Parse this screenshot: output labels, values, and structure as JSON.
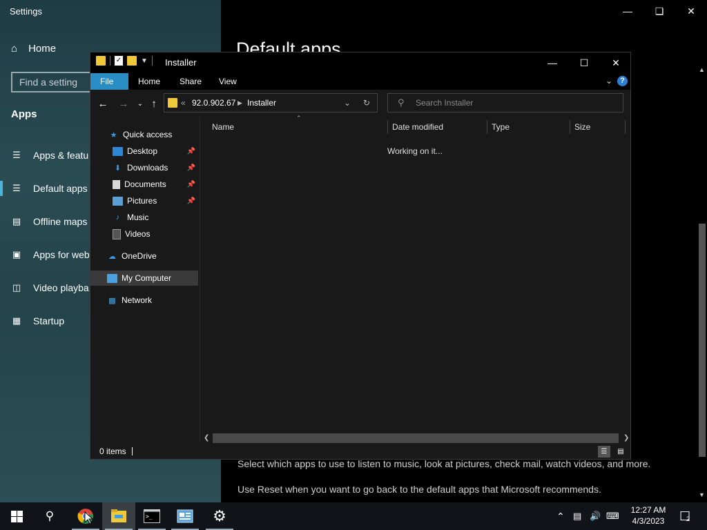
{
  "settings": {
    "title": "Settings",
    "home_label": "Home",
    "search_placeholder": "Find a setting",
    "section_heading": "Apps",
    "nav_items": [
      {
        "label": "Apps & featu",
        "icon": "list-icon"
      },
      {
        "label": "Default apps",
        "icon": "default-apps-icon"
      },
      {
        "label": "Offline maps",
        "icon": "map-icon"
      },
      {
        "label": "Apps for web",
        "icon": "web-apps-icon"
      },
      {
        "label": "Video playba",
        "icon": "video-icon"
      },
      {
        "label": "Startup",
        "icon": "startup-icon"
      }
    ],
    "page_title": "Default apps",
    "desc_1": "Select which apps to use to listen to music, look at pictures, check mail, watch videos, and more.",
    "desc_2": "Use Reset when you want to go back to the default apps that Microsoft recommends."
  },
  "explorer": {
    "title": "Installer",
    "ribbon_tabs": {
      "file": "File",
      "home": "Home",
      "share": "Share",
      "view": "View"
    },
    "help": "?",
    "address": {
      "overflow": "«",
      "crumb1": "92.0.902.67",
      "crumb2": "Installer"
    },
    "search_placeholder": "Search Installer",
    "nav": {
      "quick_access": "Quick access",
      "desktop": "Desktop",
      "downloads": "Downloads",
      "documents": "Documents",
      "pictures": "Pictures",
      "music": "Music",
      "videos": "Videos",
      "onedrive": "OneDrive",
      "my_computer": "My Computer",
      "network": "Network"
    },
    "columns": {
      "name": "Name",
      "date": "Date modified",
      "type": "Type",
      "size": "Size"
    },
    "status_message": "Working on it...",
    "item_count": "0 items"
  },
  "taskbar": {
    "time": "12:27 AM",
    "date": "4/3/2023",
    "notification_count": "2"
  },
  "colors": {
    "accent": "#2a8ec4",
    "folder": "#f0c93a",
    "selection": "#3a3a3a"
  }
}
